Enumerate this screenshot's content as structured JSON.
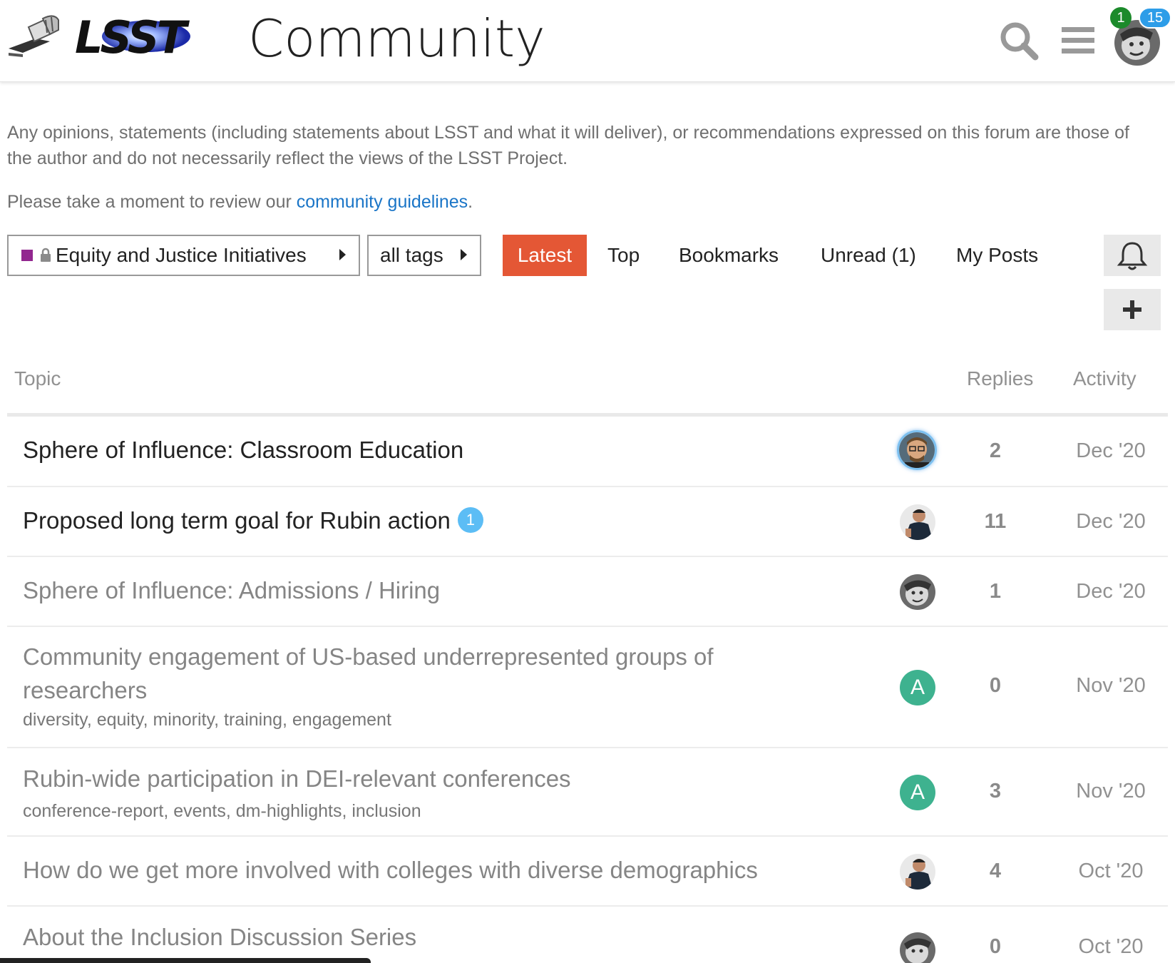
{
  "header": {
    "site_title": "Community",
    "logo_text": "LSST",
    "notifications_count": "1",
    "messages_count": "15"
  },
  "banner": {
    "disclaimer": "Any opinions, statements (including statements about LSST and what it will deliver), or recommendations expressed on this forum are those of the author and do not necessarily reflect the views of the LSST Project.",
    "guidelines_prefix": "Please take a moment to review our ",
    "guidelines_link": "community guidelines",
    "guidelines_suffix": "."
  },
  "nav": {
    "category": "Equity and Justice Initiatives",
    "category_color": "#92278f",
    "tags": "all tags",
    "latest": "Latest",
    "top": "Top",
    "bookmarks": "Bookmarks",
    "unread": "Unread (1)",
    "my_posts": "My Posts",
    "latest_color": "#e45735"
  },
  "table": {
    "headers": {
      "topic": "Topic",
      "replies": "Replies",
      "activity": "Activity"
    },
    "rows": [
      {
        "title": "Sphere of Influence: Classroom Education",
        "tags": "",
        "replies": "2",
        "activity": "Dec '20",
        "unread": true,
        "new_count": "",
        "avatar": "photo"
      },
      {
        "title": "Proposed long term goal for Rubin action",
        "tags": "",
        "replies": "11",
        "activity": "Dec '20",
        "unread": true,
        "new_count": "1",
        "avatar": "photo"
      },
      {
        "title": "Sphere of Influence: Admissions / Hiring",
        "tags": "",
        "replies": "1",
        "activity": "Dec '20",
        "unread": false,
        "new_count": "",
        "avatar": "photo"
      },
      {
        "title": "Community engagement of US-based underrepresented groups of researchers",
        "tags": "diversity, equity, minority, training, engagement",
        "replies": "0",
        "activity": "Nov '20",
        "unread": false,
        "new_count": "",
        "avatar": "A"
      },
      {
        "title": "Rubin-wide participation in DEI-relevant conferences",
        "tags": "conference-report, events, dm-highlights, inclusion",
        "replies": "3",
        "activity": "Nov '20",
        "unread": false,
        "new_count": "",
        "avatar": "A"
      },
      {
        "title": "How do we get more involved with colleges with diverse demographics",
        "tags": "",
        "replies": "4",
        "activity": "Oct '20",
        "unread": false,
        "new_count": "",
        "avatar": "photo"
      },
      {
        "title": "About the Inclusion Discussion Series",
        "tags": "",
        "replies": "0",
        "activity": "Oct '20",
        "unread": false,
        "new_count": "",
        "avatar": "photo"
      }
    ]
  }
}
